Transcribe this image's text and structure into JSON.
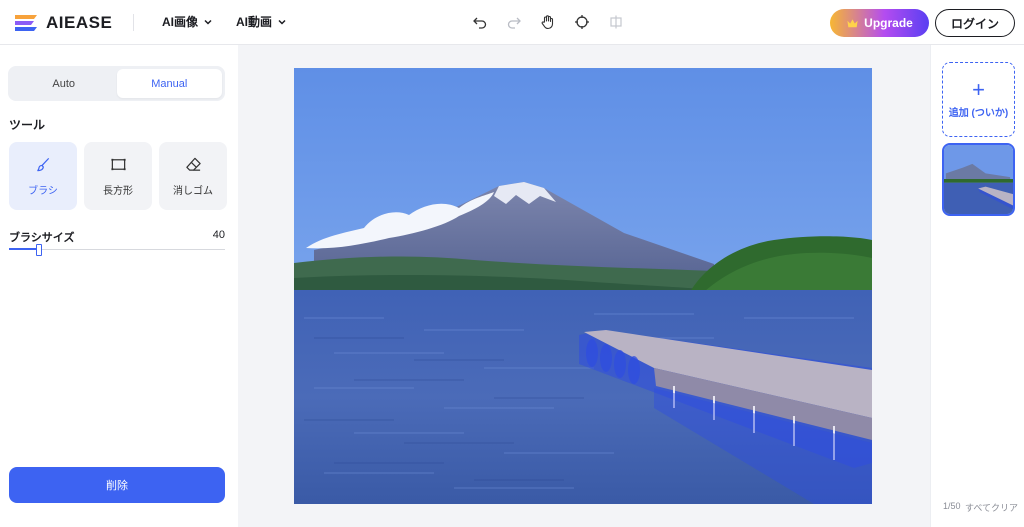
{
  "header": {
    "brand": "AIEASE",
    "nav": [
      {
        "label": "AI画像"
      },
      {
        "label": "AI動画"
      }
    ],
    "toolbar": {
      "undo_icon": "undo-icon",
      "redo_icon": "redo-icon",
      "pan_icon": "hand-icon",
      "target_icon": "crosshair-icon",
      "compare_icon": "compare-icon"
    },
    "upgrade_label": "Upgrade",
    "login_label": "ログイン"
  },
  "left_panel": {
    "mode_tabs": [
      {
        "label": "Auto",
        "active": false
      },
      {
        "label": "Manual",
        "active": true
      }
    ],
    "tools_title": "ツール",
    "tools": [
      {
        "label": "ブラシ",
        "icon": "brush-icon",
        "active": true
      },
      {
        "label": "長方形",
        "icon": "rectangle-icon",
        "active": false
      },
      {
        "label": "消しゴム",
        "icon": "eraser-icon",
        "active": false
      }
    ],
    "brush_size_label": "ブラシサイズ",
    "brush_size_value": "40",
    "brush_size_fraction": 0.14,
    "delete_label": "削除"
  },
  "right_panel": {
    "add_label": "追加 (ついか)",
    "counter": "1/50",
    "clear_all_label": "すべてクリア"
  },
  "colors": {
    "accent": "#3d63f2",
    "mask": "#2f4de0"
  }
}
